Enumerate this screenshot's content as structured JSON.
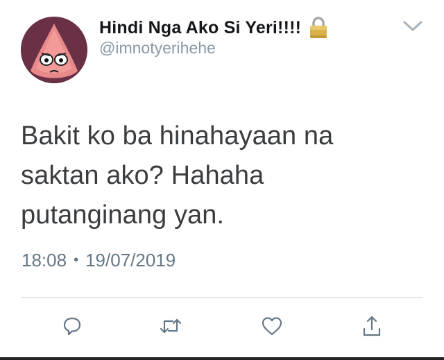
{
  "author": {
    "display_name": "Hindi Nga Ako Si Yeri!!!!",
    "handle": "@imnotyerihehe",
    "protected_icon": "lock-icon",
    "avatar": "patrick-star-avatar"
  },
  "menu": {
    "icon": "chevron-down-icon"
  },
  "tweet": {
    "lines": [
      "Bakit ko ba hinahayaan na",
      "saktan ako? Hahaha",
      "putanginang yan."
    ],
    "time": "18:08",
    "date": "19/07/2019",
    "separator": "•"
  },
  "actions": [
    {
      "icon": "reply-icon"
    },
    {
      "icon": "retweet-icon"
    },
    {
      "icon": "like-icon"
    },
    {
      "icon": "share-icon"
    }
  ],
  "colors": {
    "primary_text": "#14171a",
    "secondary_text": "#657786",
    "icon_gray": "#657786",
    "divider": "#cfd6dc"
  }
}
